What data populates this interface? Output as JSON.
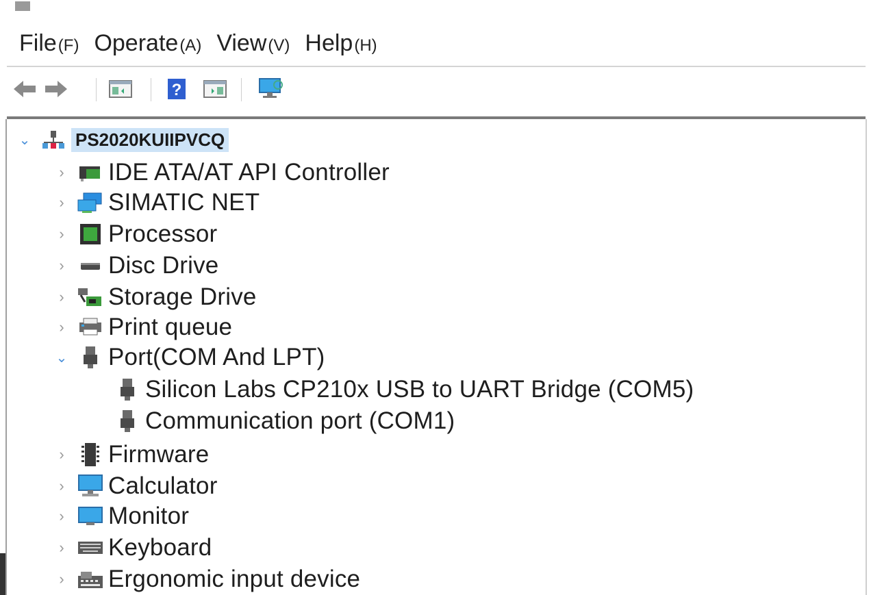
{
  "menu": [
    {
      "label": "File",
      "accel": "(F)"
    },
    {
      "label": "Operate",
      "accel": "(A)"
    },
    {
      "label": "View",
      "accel": "(V)"
    },
    {
      "label": "Help",
      "accel": "(H)"
    }
  ],
  "toolbar": {
    "buttons": [
      {
        "icon": "back-arrow-icon"
      },
      {
        "icon": "forward-arrow-icon"
      },
      {
        "icon": "console-tree-icon"
      },
      {
        "icon": "help-icon"
      },
      {
        "icon": "action-pane-icon"
      },
      {
        "icon": "monitor-icon"
      }
    ]
  },
  "tree": {
    "root": {
      "label": "PS2020KUIIPVCQ",
      "icon": "computer-network-icon",
      "expanded": true
    },
    "categories": [
      {
        "label": "IDE ATA/AT API Controller",
        "icon": "ide-controller-icon",
        "expanded": false
      },
      {
        "label": "SIMATIC NET",
        "icon": "network-icon",
        "expanded": false
      },
      {
        "label": "Processor",
        "icon": "processor-icon",
        "expanded": false
      },
      {
        "label": "Disc Drive",
        "icon": "disk-drive-icon",
        "expanded": false
      },
      {
        "label": "Storage Drive",
        "icon": "storage-controller-icon",
        "expanded": false
      },
      {
        "label": "Print queue",
        "icon": "printer-icon",
        "expanded": false
      },
      {
        "label": "Port(COM And LPT)",
        "icon": "port-icon",
        "expanded": true,
        "children": [
          {
            "label": "Silicon Labs CP210x USB to UART Bridge (COM5)",
            "icon": "port-icon"
          },
          {
            "label": "Communication port (COM1)",
            "icon": "port-icon"
          }
        ]
      },
      {
        "label": "Firmware",
        "icon": "firmware-icon",
        "expanded": false
      },
      {
        "label": "Calculator",
        "icon": "computer-icon",
        "expanded": false
      },
      {
        "label": "Monitor",
        "icon": "monitor-icon",
        "expanded": false
      },
      {
        "label": "Keyboard",
        "icon": "keyboard-icon",
        "expanded": false
      },
      {
        "label": "Ergonomic input device",
        "icon": "hid-icon",
        "expanded": false
      }
    ]
  },
  "colors": {
    "selection": "#cde3f7",
    "expand_chevron": "#4a90d9",
    "collapse_chevron": "#9a9a9a"
  }
}
